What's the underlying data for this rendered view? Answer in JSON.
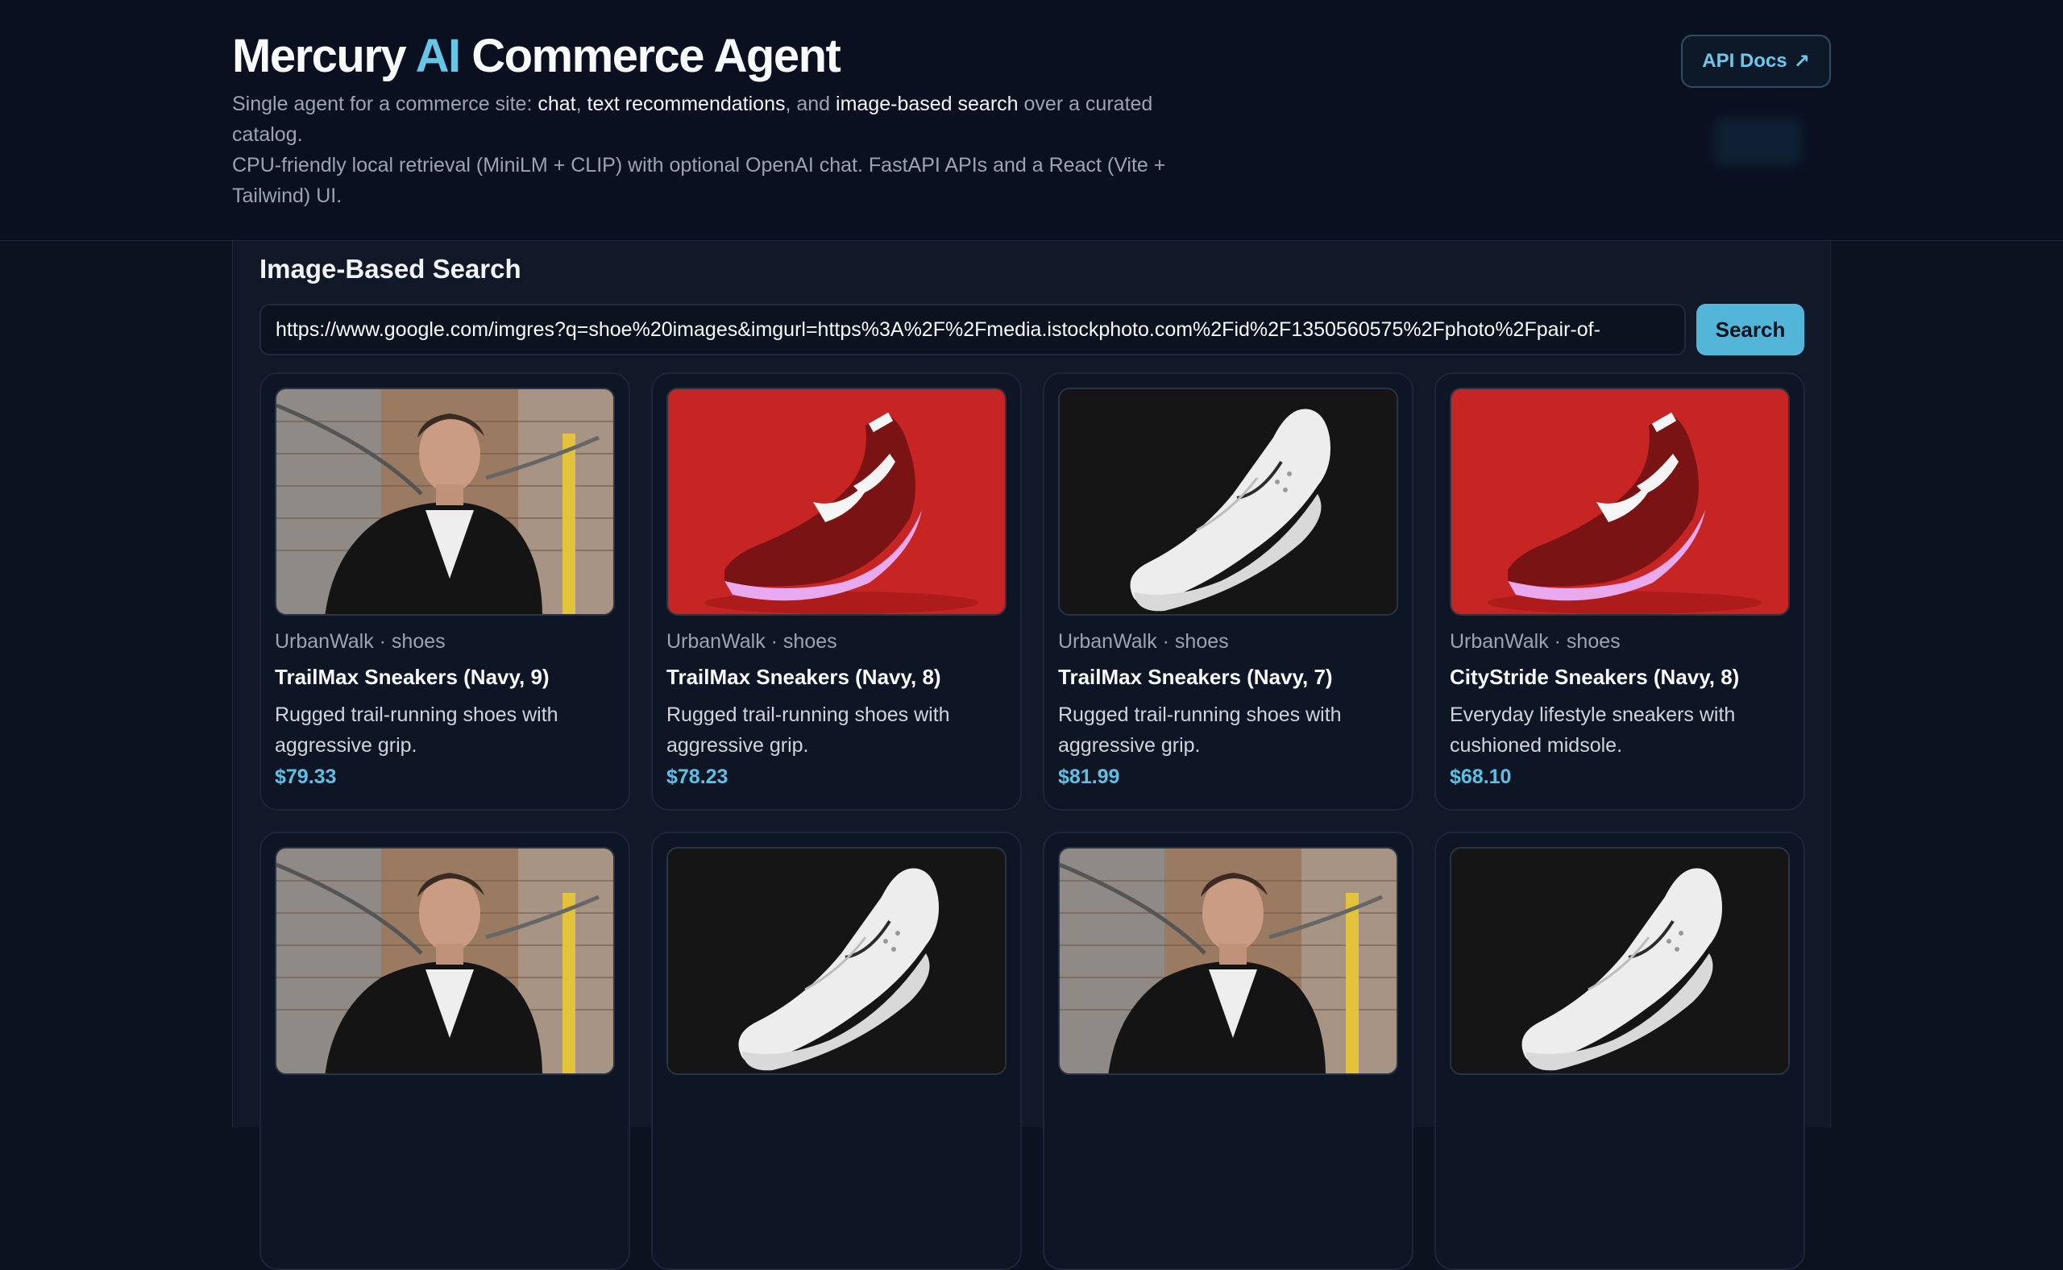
{
  "header": {
    "title_part1": "Mercury ",
    "title_ai": "AI",
    "title_part2": " Commerce Agent",
    "subtitle_line1_prefix": "Single agent for a commerce site: ",
    "subtitle_chat": "chat",
    "subtitle_sep1": ", ",
    "subtitle_text_recs": "text recommendations",
    "subtitle_sep2": ", and ",
    "subtitle_image_search": "image-based search",
    "subtitle_line1_suffix": " over a curated catalog.",
    "subtitle_line2": "CPU-friendly local retrieval (MiniLM + CLIP) with optional OpenAI chat. FastAPI APIs and a React (Vite + Tailwind) UI.",
    "api_docs_label": "API Docs",
    "api_docs_icon": "↗"
  },
  "panel": {
    "title": "Image-Based Search",
    "search_value": "https://www.google.com/imgres?q=shoe%20images&imgurl=https%3A%2F%2Fmedia.istockphoto.com%2Fid%2F1350560575%2Fphoto%2Fpair-of-",
    "search_button": "Search"
  },
  "products": [
    {
      "image": "model-leather-jacket",
      "meta": "UrbanWalk · shoes",
      "name": "TrailMax Sneakers (Navy, 9)",
      "desc": "Rugged trail-running shoes with aggressive grip.",
      "price": "$79.33"
    },
    {
      "image": "red-nike-shoe",
      "meta": "UrbanWalk · shoes",
      "name": "TrailMax Sneakers (Navy, 8)",
      "desc": "Rugged trail-running shoes with aggressive grip.",
      "price": "$78.23"
    },
    {
      "image": "white-puma-shoe",
      "meta": "UrbanWalk · shoes",
      "name": "TrailMax Sneakers (Navy, 7)",
      "desc": "Rugged trail-running shoes with aggressive grip.",
      "price": "$81.99"
    },
    {
      "image": "red-nike-shoe",
      "meta": "UrbanWalk · shoes",
      "name": "CityStride Sneakers (Navy, 8)",
      "desc": "Everyday lifestyle sneakers with cushioned midsole.",
      "price": "$68.10"
    },
    {
      "image": "model-leather-jacket",
      "meta": "",
      "name": "",
      "desc": "",
      "price": ""
    },
    {
      "image": "white-puma-shoe",
      "meta": "",
      "name": "",
      "desc": "",
      "price": ""
    },
    {
      "image": "model-leather-jacket",
      "meta": "",
      "name": "",
      "desc": "",
      "price": ""
    },
    {
      "image": "white-puma-shoe",
      "meta": "",
      "name": "",
      "desc": "",
      "price": ""
    }
  ],
  "colors": {
    "accent": "#53b5d7",
    "price": "#5ec0e4",
    "background": "#0b1220",
    "panel": "#111827"
  }
}
